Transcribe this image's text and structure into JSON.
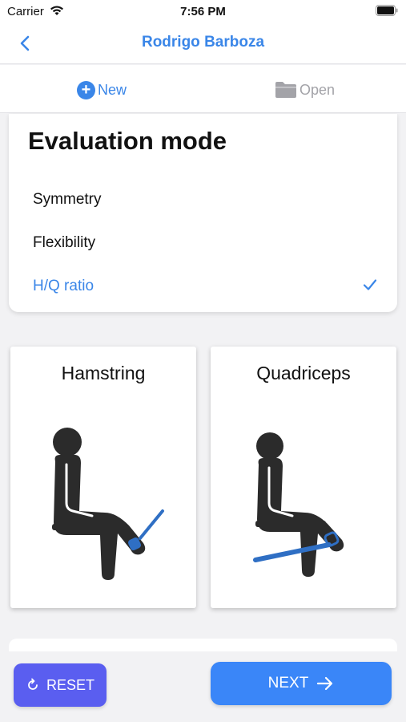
{
  "status_bar": {
    "carrier": "Carrier",
    "time": "7:56 PM"
  },
  "nav": {
    "title": "Rodrigo Barboza",
    "back_icon": "chevron-left-icon"
  },
  "segments": {
    "new_label": "New",
    "open_label": "Open"
  },
  "evaluation": {
    "title": "Evaluation mode",
    "options": [
      {
        "label": "Symmetry",
        "selected": false
      },
      {
        "label": "Flexibility",
        "selected": false
      },
      {
        "label": "H/Q ratio",
        "selected": true
      }
    ]
  },
  "muscles": [
    {
      "label": "Hamstring"
    },
    {
      "label": "Quadriceps"
    }
  ],
  "actions": {
    "reset_label": "RESET",
    "next_label": "NEXT"
  },
  "colors": {
    "accent": "#3a86e8",
    "reset": "#5a5ef0",
    "next": "#3a86f8",
    "figure": "#2b2b2b",
    "strap": "#2f6fc4"
  }
}
